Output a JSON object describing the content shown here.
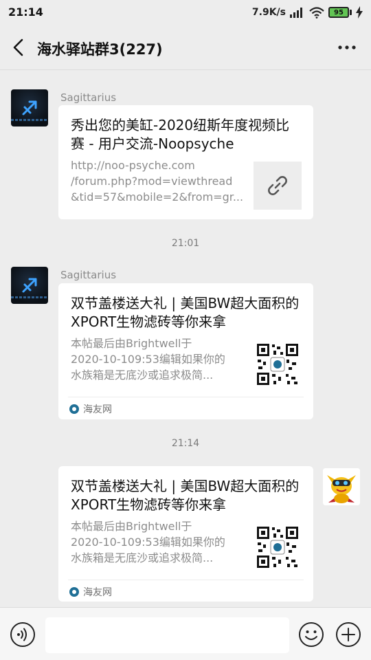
{
  "status_bar": {
    "time": "21:14",
    "net_speed": "7.9K/s",
    "battery": "95",
    "icons": [
      "signal-icon",
      "wifi-icon",
      "battery-icon",
      "charging-icon"
    ]
  },
  "nav": {
    "title": "海水驿站群3(227)",
    "back_icon": "chevron-left-icon",
    "more_icon": "more-icon"
  },
  "messages": [
    {
      "sender": "Sagittarius",
      "title": "秀出您的美缸-2020纽斯年度视频比赛 - 用户交流-Noopsyche",
      "desc_lines": [
        "http://noo-psyche.com",
        "/forum.php?mod=viewthread",
        "&tid=57&mobile=2&from=gr..."
      ],
      "thumb_icon": "link-icon"
    },
    {
      "time": "21:01",
      "sender": "Sagittarius",
      "title": "双节盖楼送大礼 | 美国BW超大面积的XPORT生物滤砖等你来拿",
      "desc_lines": [
        "本帖最后由Brightwell于",
        "2020-10-109:53编辑如果你的",
        "水族箱是无底沙或追求极简..."
      ],
      "thumb_icon": "qr-code-icon",
      "source": "海友网"
    },
    {
      "time": "21:14",
      "title": "双节盖楼送大礼 | 美国BW超大面积的XPORT生物滤砖等你来拿",
      "desc_lines": [
        "本帖最后由Brightwell于",
        "2020-10-109:53编辑如果你的",
        "水族箱是无底沙或追求极简..."
      ],
      "thumb_icon": "qr-code-icon",
      "source": "海友网"
    }
  ],
  "input_bar": {
    "placeholder": "",
    "voice_icon": "voice-icon",
    "emoji_icon": "emoji-icon",
    "add_icon": "add-icon"
  },
  "colors": {
    "background": "#ededed",
    "card": "#ffffff",
    "battery_fill": "#62c554",
    "source_icon": "#1f6f96"
  }
}
